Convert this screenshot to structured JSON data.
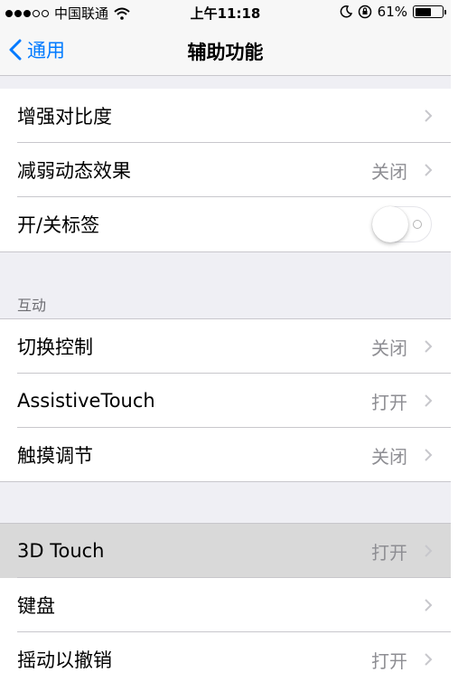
{
  "status": {
    "carrier": "中国联通",
    "time": "上午11:18",
    "battery": "61%",
    "battery_level": 0.61
  },
  "nav": {
    "back_label": "通用",
    "title": "辅助功能"
  },
  "group1": [
    {
      "label": "增强对比度",
      "value": ""
    },
    {
      "label": "减弱动态效果",
      "value": "关闭"
    },
    {
      "label": "开/关标签",
      "value": ""
    }
  ],
  "interaction_header": "互动",
  "group2": [
    {
      "label": "切换控制",
      "value": "关闭"
    },
    {
      "label": "AssistiveTouch",
      "value": "打开"
    },
    {
      "label": "触摸调节",
      "value": "关闭"
    }
  ],
  "group3": [
    {
      "label": "3D Touch",
      "value": "打开"
    },
    {
      "label": "键盘",
      "value": ""
    },
    {
      "label": "摇动以撤销",
      "value": "打开"
    }
  ],
  "colors": {
    "accent": "#007aff",
    "value_gray": "#8e8e93",
    "background": "#efeff4"
  }
}
